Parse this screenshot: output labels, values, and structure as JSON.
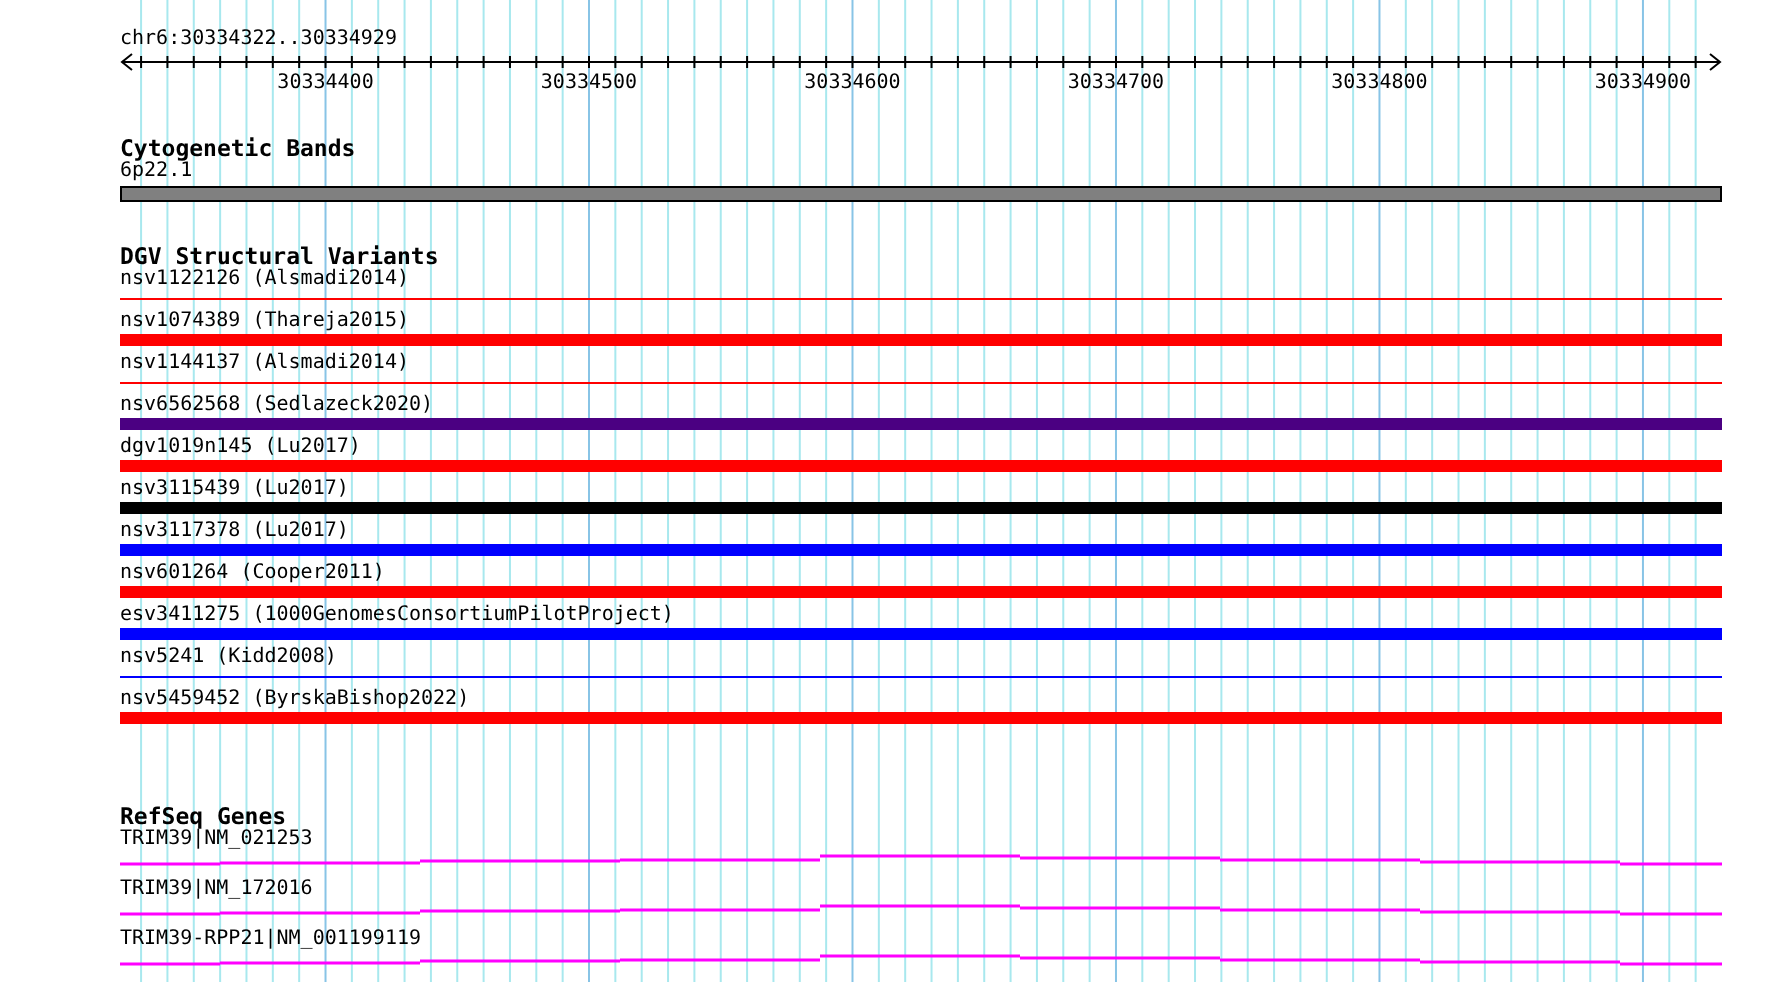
{
  "ruler": {
    "region": "chr6:30334322..30334929",
    "tick_labels": [
      "30334400",
      "30334500",
      "30334600",
      "30334700",
      "30334800",
      "30334900"
    ]
  },
  "cytogenetic_bands": {
    "title": "Cytogenetic Bands",
    "band": "6p22.1"
  },
  "dgv_structural_variants": {
    "title": "DGV Structural Variants",
    "variants": [
      {
        "label": "nsv1122126 (Alsmadi2014)",
        "kind": "line",
        "color": "#ff0000"
      },
      {
        "label": "nsv1074389 (Thareja2015)",
        "kind": "bar",
        "color": "#ff0000"
      },
      {
        "label": "nsv1144137 (Alsmadi2014)",
        "kind": "line",
        "color": "#ff0000"
      },
      {
        "label": "nsv6562568 (Sedlazeck2020)",
        "kind": "bar",
        "color": "#4b0082"
      },
      {
        "label": "dgv1019n145 (Lu2017)",
        "kind": "bar",
        "color": "#ff0000"
      },
      {
        "label": "nsv3115439 (Lu2017)",
        "kind": "bar",
        "color": "#000000"
      },
      {
        "label": "nsv3117378 (Lu2017)",
        "kind": "bar",
        "color": "#0000ff"
      },
      {
        "label": "nsv601264 (Cooper2011)",
        "kind": "bar",
        "color": "#ff0000"
      },
      {
        "label": "esv3411275 (1000GenomesConsortiumPilotProject)",
        "kind": "bar",
        "color": "#0000ff"
      },
      {
        "label": "nsv5241 (Kidd2008)",
        "kind": "line",
        "color": "#0000ff"
      },
      {
        "label": "nsv5459452 (ByrskaBishop2022)",
        "kind": "bar",
        "color": "#ff0000"
      }
    ]
  },
  "refseq_genes": {
    "title": "RefSeq Genes",
    "genes": [
      {
        "label": "TRIM39|NM_021253"
      },
      {
        "label": "TRIM39|NM_172016"
      },
      {
        "label": "TRIM39-RPP21|NM_001199119"
      }
    ]
  }
}
